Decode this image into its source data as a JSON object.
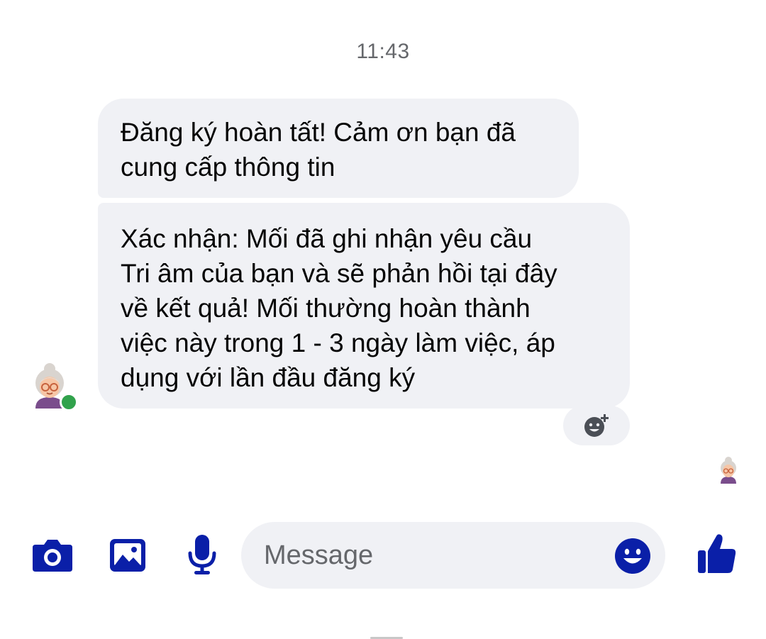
{
  "chat": {
    "timestamp": "11:43",
    "messages": [
      {
        "sender": "contact",
        "text": "Đăng ký hoàn tất! Cảm ơn bạn đã\ncung cấp thông tin"
      },
      {
        "sender": "contact",
        "text": "Xác nhận: Mối đã ghi nhận yêu cầu\nTri âm của bạn và sẽ phản hồi tại đây\nvề kết quả! Mối thường hoàn thành\nviệc này trong 1 - 3 ngày làm việc, áp\ndụng với lần đầu đăng ký"
      }
    ],
    "contact_avatar_icon": "grandma-avatar",
    "online_status_color": "#31a24c",
    "reaction_icon": "add-reaction-icon",
    "seen_avatar_icon": "grandma-avatar"
  },
  "composer": {
    "placeholder": "Message",
    "left_icons": [
      "camera-icon",
      "gallery-icon",
      "microphone-icon"
    ],
    "emoji_icon": "emoji-icon",
    "send_icon": "thumbs-up-icon"
  },
  "colors": {
    "accent": "#0a1fa8",
    "bubble": "#f0f1f5",
    "muted_text": "#65676b"
  }
}
